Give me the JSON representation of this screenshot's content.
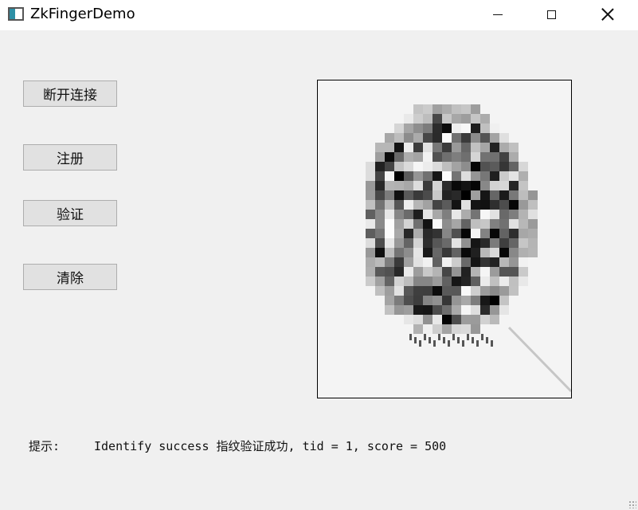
{
  "window": {
    "title": "ZkFingerDemo",
    "icon": "app-window-icon",
    "controls": [
      "minimize-icon",
      "maximize-icon",
      "close-icon"
    ]
  },
  "buttons": {
    "disconnect": "断开连接",
    "register": "注册",
    "verify": "验证",
    "clear": "清除"
  },
  "fingerprint": {
    "image": "fingerprint-scan (pixelated)"
  },
  "status": {
    "label": "提示:",
    "message": "Identify success 指纹验证成功, tid = 1, score = 500"
  }
}
